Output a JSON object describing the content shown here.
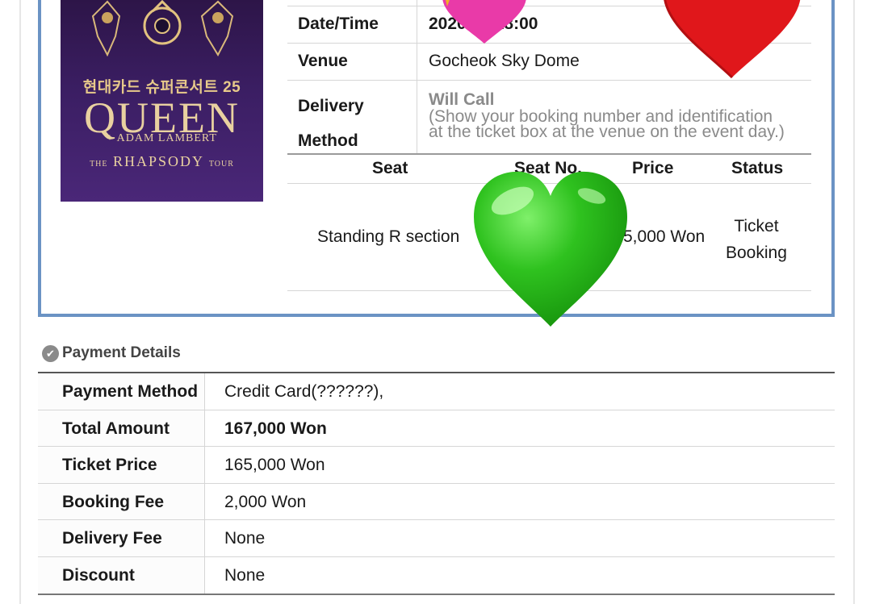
{
  "poster": {
    "korean_title": "현대카드 슈퍼콘서트 25",
    "queen": "QUEEN",
    "adam": "+ ADAM LAMBERT",
    "tour_prefix": "THE",
    "tour_main": "RHAPSODY",
    "tour_suffix": "TOUR"
  },
  "booking_info": {
    "datetime_label": "Date/Time",
    "datetime_value": "2020  19 18:00",
    "venue_label": "Venue",
    "venue_value": "Gocheok Sky Dome",
    "delivery_label_1": "Delivery",
    "delivery_label_2": "Method",
    "delivery_value": "Will Call",
    "delivery_note_1": "(Show your booking number and identification",
    "delivery_note_2": "at the ticket box at the venue on the event day.)"
  },
  "seat_table": {
    "headers": {
      "seat": "Seat",
      "seat_no": "Seat No.",
      "price": "Price",
      "status": "Status"
    },
    "row": {
      "seat": "Standing R section",
      "price": "5,000 Won",
      "status_1": "Ticket",
      "status_2": "Booking"
    }
  },
  "payment": {
    "section_title": "Payment Details",
    "rows": [
      {
        "label": "Payment Method",
        "value": "Credit Card(??????),"
      },
      {
        "label": "Total Amount",
        "value": "167,000 Won"
      },
      {
        "label": "Ticket Price",
        "value": "165,000 Won"
      },
      {
        "label": "Booking Fee",
        "value": "2,000 Won"
      },
      {
        "label": "Delivery Fee",
        "value": "None"
      },
      {
        "label": "Discount",
        "value": "None"
      }
    ]
  },
  "colors": {
    "frame_blue": "#6b93c4",
    "green_heart": "#2fc21f",
    "red_heart": "#e0171b",
    "pink_heart": "#e93aa8",
    "gold": "#e7c98a"
  },
  "icons": {
    "section": "check-circle-icon",
    "overlay_1": "green-heart-icon",
    "overlay_2": "red-heart-icon",
    "overlay_3": "pink-heart-icon"
  }
}
